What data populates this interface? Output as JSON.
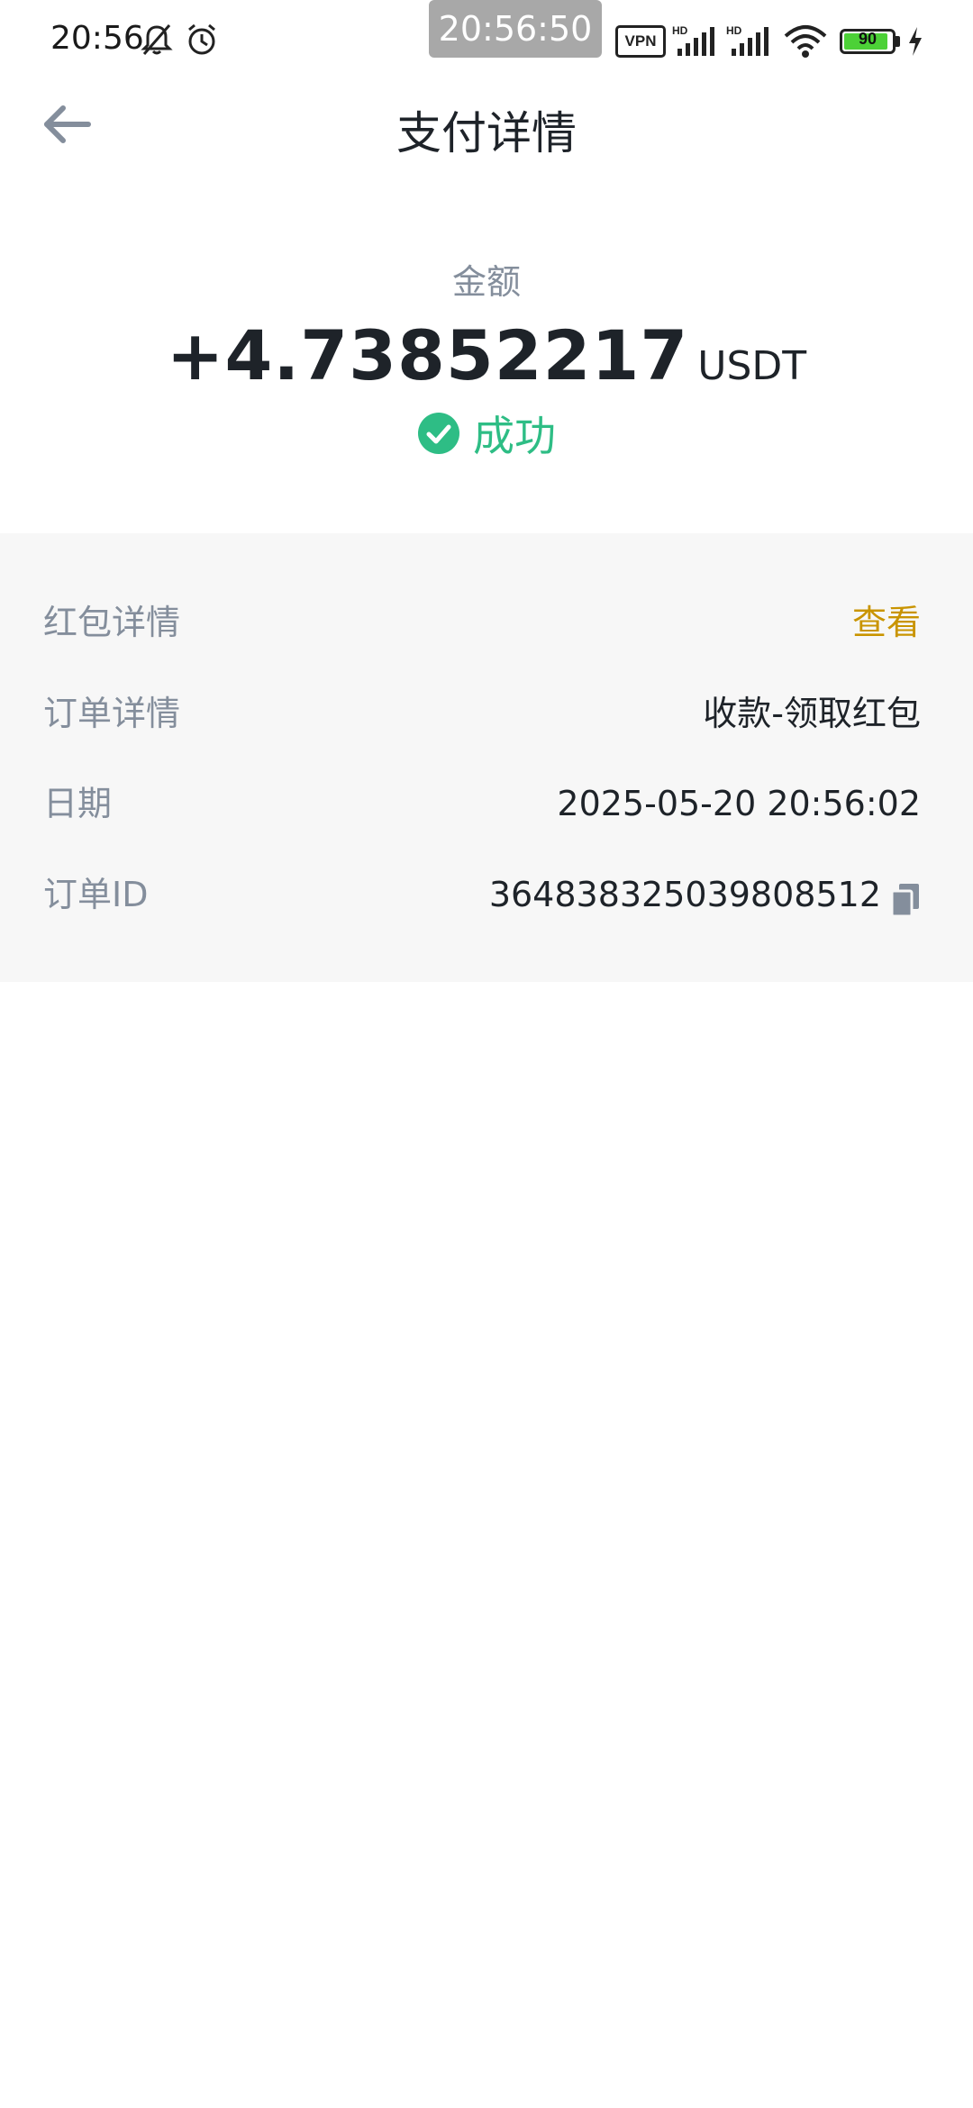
{
  "status_bar": {
    "time": "20:56",
    "clock_overlay": "20:56:50",
    "vpn": "VPN",
    "battery_level": "90",
    "signal_labels": [
      "HD",
      "HD"
    ]
  },
  "header": {
    "title": "支付详情"
  },
  "summary": {
    "amount_label": "金额",
    "amount": "+4.73852217",
    "unit": "USDT",
    "status": "成功"
  },
  "details": [
    {
      "label": "红包详情",
      "value": "查看"
    },
    {
      "label": "订单详情",
      "value": "收款-领取红包"
    },
    {
      "label": "日期",
      "value": "2025-05-20 20:56:02"
    },
    {
      "label": "订单ID",
      "value": "364838325039808512"
    }
  ],
  "colors": {
    "success": "#2ebd85",
    "link": "#c99400",
    "muted": "#848e9c",
    "panel_bg": "#f7f7f7"
  }
}
